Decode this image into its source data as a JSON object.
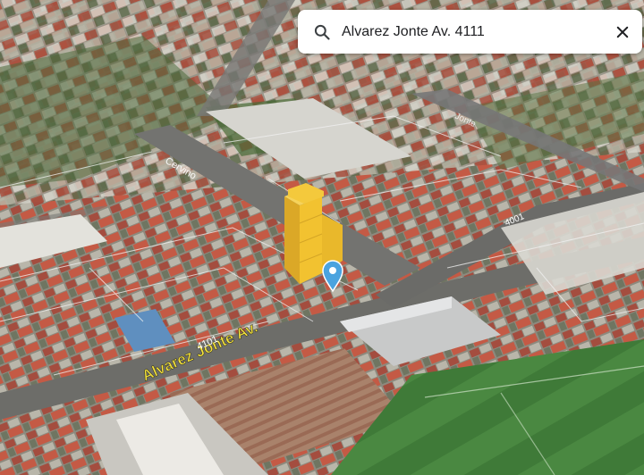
{
  "search": {
    "query": "Alvarez Jonte Av. 4111",
    "search_icon": "search-icon",
    "close_icon": "close-icon"
  },
  "map": {
    "view": "3d-satellite",
    "street_main_label": "Alvarez Jonte Av.",
    "address_number_main": "4101",
    "address_number_east": "4001",
    "cross_street_label": "Cervino",
    "cross_street_ne_label": "Jonte",
    "marker_icon": "location-pin-icon",
    "colors": {
      "highlight_building": "#f2c230",
      "marker": "#4aa3df",
      "street_label": "#f4e23a",
      "field": "#3f7a38"
    }
  }
}
